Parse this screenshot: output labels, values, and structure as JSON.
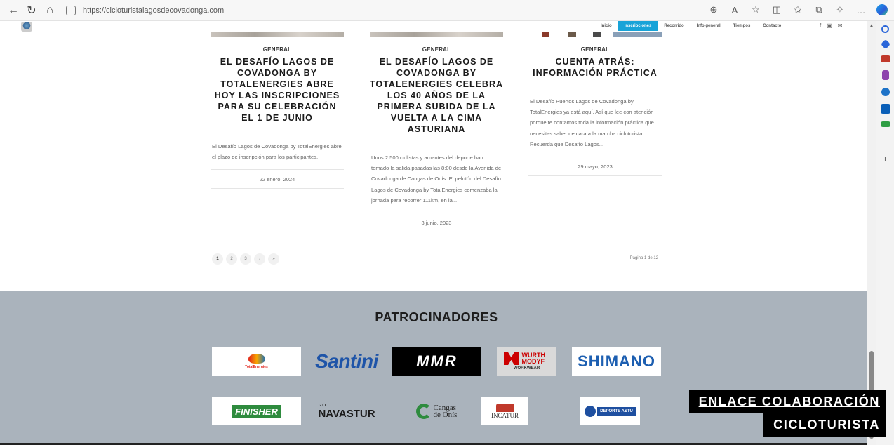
{
  "browser": {
    "url": "https://cicloturistalagosdecovadonga.com",
    "toolbar_icons": [
      "zoom-icon",
      "read-aloud-icon",
      "favorite-star-icon",
      "split-screen-icon",
      "favorites-icon",
      "collections-icon",
      "extensions-icon",
      "more-icon",
      "copilot-icon"
    ],
    "sidebar_icons": [
      {
        "name": "search-icon",
        "color": "#2b66d9"
      },
      {
        "name": "tag-icon",
        "color": "#2b66d9"
      },
      {
        "name": "briefcase-icon",
        "color": "#c0392b"
      },
      {
        "name": "games-icon",
        "color": "#8e44ad"
      },
      {
        "name": "office-icon",
        "color": "#1e73c8"
      },
      {
        "name": "outlook-icon",
        "color": "#0a5fb8"
      },
      {
        "name": "designer-icon",
        "color": "#2f9e44"
      },
      {
        "name": "add-icon",
        "color": "#555555"
      }
    ]
  },
  "site": {
    "menu": [
      {
        "label": "Inicio",
        "active": false
      },
      {
        "label": "Inscripciones",
        "active": true
      },
      {
        "label": "Recorrido",
        "active": false
      },
      {
        "label": "Info general",
        "active": false
      },
      {
        "label": "Tiempos",
        "active": false
      },
      {
        "label": "Contacto",
        "active": false
      }
    ],
    "social": [
      "f",
      "▣",
      "✉"
    ]
  },
  "posts": [
    {
      "category": "GENERAL",
      "title": "EL DESAFÍO LAGOS DE COVADONGA BY TOTALENERGIES ABRE HOY LAS INSCRIPCIONES PARA SU CELEBRACIÓN EL 1 DE JUNIO",
      "excerpt": "El Desafío Lagos de Covadonga by TotalEnergies abre el plazo de inscripción para los participantes.",
      "date": "22 enero, 2024"
    },
    {
      "category": "GENERAL",
      "title": "EL DESAFÍO LAGOS DE COVADONGA BY TOTALENERGIES CELEBRA LOS 40 AÑOS DE LA PRIMERA SUBIDA DE LA VUELTA A LA CIMA ASTURIANA",
      "excerpt": "Unos 2.500 ciclistas y amantes del deporte han tomado la salida pasadas las 8:00 desde la Avenida de Covadonga de Cangas de Onís. El pelotón del Desafío Lagos de Covadonga by TotalEnergies comenzaba la jornada para recorrer 111km, en la...",
      "date": "3 junio, 2023"
    },
    {
      "category": "GENERAL",
      "title": "CUENTA ATRÁS: INFORMACIÓN PRÁCTICA",
      "excerpt": "El Desafío Puertos Lagos de Covadonga by TotalEnergies ya está aquí. Así que lee con atención porque te contamos toda la información práctica que necesitas saber de cara a la marcha cicloturista. Recuerda que Desafío Lagos...",
      "date": "29 mayo, 2023"
    }
  ],
  "pagination": {
    "pages": [
      "1",
      "2",
      "3",
      "›",
      "»"
    ],
    "current": "1",
    "summary": "Página 1 de 12"
  },
  "sponsors": {
    "title": "PATROCINADORES",
    "logos": [
      {
        "name": "TotalEnergies",
        "text": "TotalEnergies"
      },
      {
        "name": "Santini",
        "text": "Santini"
      },
      {
        "name": "MMR",
        "text": "MMR"
      },
      {
        "name": "Würth Modyf",
        "text": "WÜRTH MODYF",
        "sub": "WORKWEAR"
      },
      {
        "name": "Shimano",
        "text": "SHIMANO"
      },
      {
        "name": "Finisher",
        "text": "FINISHER"
      },
      {
        "name": "Navastur",
        "text": "NAVASTUR",
        "sub": "G.I.T."
      },
      {
        "name": "Cangas de Onís",
        "text": "Cangas de Onís"
      },
      {
        "name": "Incatur",
        "text": "INCATUR"
      },
      {
        "name": "Deporte Asturiano",
        "text": "DEPORTE ASTU"
      }
    ]
  },
  "cta": {
    "line1": "ENLACE COLABORACIÓN",
    "line2": "CICLOTURISTA"
  }
}
